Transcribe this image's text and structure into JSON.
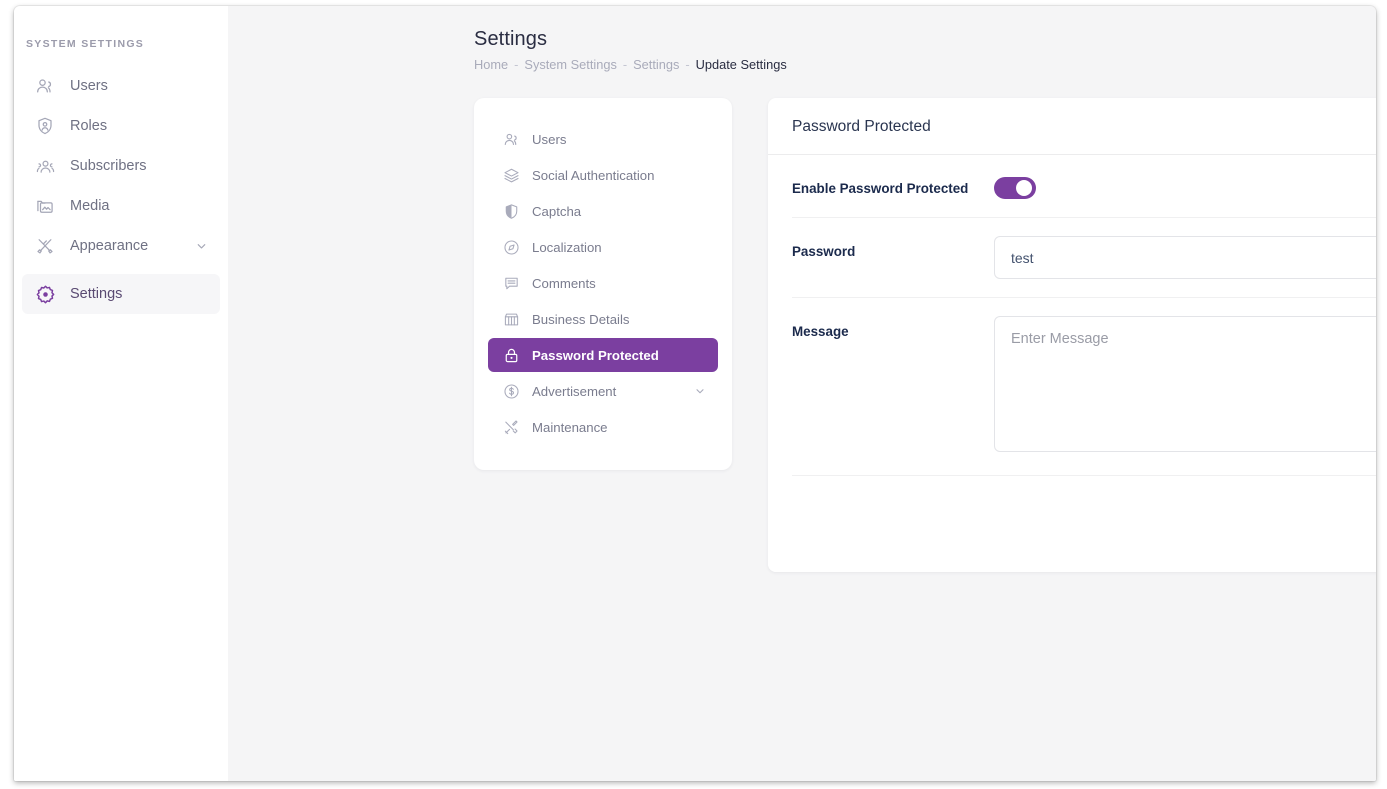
{
  "sidebar": {
    "heading": "SYSTEM SETTINGS",
    "items": [
      {
        "label": "Users",
        "icon": "users-icon",
        "active": false,
        "caret": false
      },
      {
        "label": "Roles",
        "icon": "shield-user-icon",
        "active": false,
        "caret": false
      },
      {
        "label": "Subscribers",
        "icon": "subscribers-icon",
        "active": false,
        "caret": false
      },
      {
        "label": "Media",
        "icon": "media-folder-icon",
        "active": false,
        "caret": false
      },
      {
        "label": "Appearance",
        "icon": "brush-icon",
        "active": false,
        "caret": true
      },
      {
        "label": "Settings",
        "icon": "gear-icon",
        "active": true,
        "caret": false
      }
    ]
  },
  "header": {
    "title": "Settings",
    "breadcrumb": [
      {
        "label": "Home",
        "current": false
      },
      {
        "label": "System Settings",
        "current": false
      },
      {
        "label": "Settings",
        "current": false
      },
      {
        "label": "Update Settings",
        "current": true
      }
    ],
    "separator": "-"
  },
  "settings_nav": {
    "items": [
      {
        "label": "Users",
        "icon": "users-icon",
        "active": false,
        "caret": false
      },
      {
        "label": "Social Authentication",
        "icon": "layers-icon",
        "active": false,
        "caret": false
      },
      {
        "label": "Captcha",
        "icon": "shield-half-icon",
        "active": false,
        "caret": false
      },
      {
        "label": "Localization",
        "icon": "compass-icon",
        "active": false,
        "caret": false
      },
      {
        "label": "Comments",
        "icon": "comment-lines-icon",
        "active": false,
        "caret": false
      },
      {
        "label": "Business Details",
        "icon": "storefront-icon",
        "active": false,
        "caret": false
      },
      {
        "label": "Password Protected",
        "icon": "lock-icon",
        "active": true,
        "caret": false
      },
      {
        "label": "Advertisement",
        "icon": "dollar-circle-icon",
        "active": false,
        "caret": true
      },
      {
        "label": "Maintenance",
        "icon": "tools-icon",
        "active": false,
        "caret": false
      }
    ]
  },
  "panel": {
    "title": "Password Protected",
    "fields": {
      "enable": {
        "label": "Enable Password Protected",
        "toggle_on": true
      },
      "password": {
        "label": "Password",
        "value": "test",
        "placeholder": ""
      },
      "message": {
        "label": "Message",
        "value": "",
        "placeholder": "Enter Message"
      }
    }
  },
  "colors": {
    "accent_purple": "#7B3FA0",
    "page_background": "#F5F5F6",
    "card_background": "#FFFFFF",
    "label_text": "#1B2A4C",
    "muted_text": "#A9ABBA"
  }
}
